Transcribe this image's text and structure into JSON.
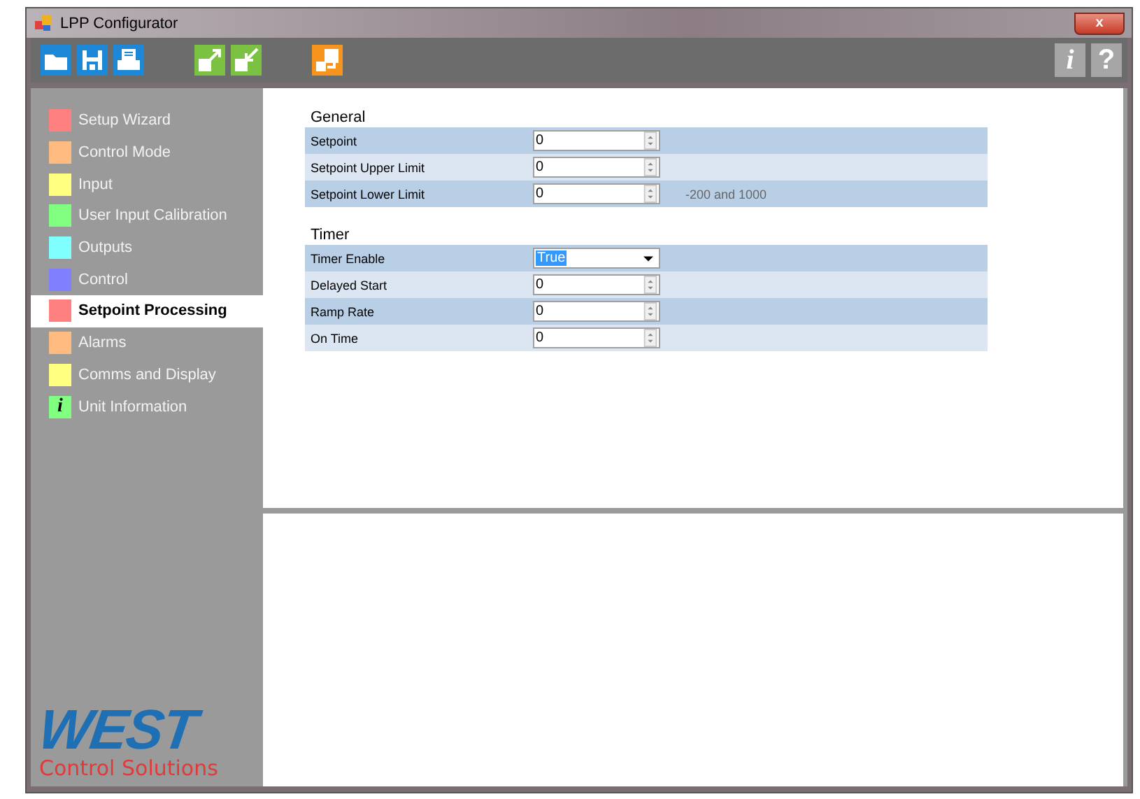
{
  "window": {
    "title": "LPP Configurator",
    "close": "x"
  },
  "toolbar": {
    "help_buttons": [
      "i",
      "?"
    ]
  },
  "sidebar": {
    "items": [
      {
        "label": "Setup Wizard",
        "color": "#ff8080",
        "selected": false,
        "kind": "swatch"
      },
      {
        "label": "Control Mode",
        "color": "#ffbb80",
        "selected": false,
        "kind": "swatch"
      },
      {
        "label": "Input",
        "color": "#ffff80",
        "selected": false,
        "kind": "swatch"
      },
      {
        "label": "User Input Calibration",
        "color": "#80ff80",
        "selected": false,
        "kind": "swatch"
      },
      {
        "label": "Outputs",
        "color": "#80ffff",
        "selected": false,
        "kind": "swatch"
      },
      {
        "label": "Control",
        "color": "#8080ff",
        "selected": false,
        "kind": "swatch"
      },
      {
        "label": "Setpoint Processing",
        "color": "#ff8080",
        "selected": true,
        "kind": "swatch"
      },
      {
        "label": "Alarms",
        "color": "#ffbb80",
        "selected": false,
        "kind": "swatch"
      },
      {
        "label": "Comms and Display",
        "color": "#ffff80",
        "selected": false,
        "kind": "swatch"
      },
      {
        "label": "Unit Information",
        "color": "#80ff80",
        "selected": false,
        "kind": "info",
        "glyph": "i"
      }
    ]
  },
  "sections": [
    {
      "title": "General",
      "rows": [
        {
          "label": "Setpoint",
          "kind": "spin",
          "value": "0"
        },
        {
          "label": "Setpoint Upper Limit",
          "kind": "spin",
          "value": "0"
        },
        {
          "label": "Setpoint Lower Limit",
          "kind": "spin",
          "value": "0",
          "note": "-200 and 1000"
        }
      ]
    },
    {
      "title": "Timer",
      "rows": [
        {
          "label": "Timer Enable",
          "kind": "dropdown",
          "value": "True"
        },
        {
          "label": "Delayed Start",
          "kind": "spin",
          "value": "0"
        },
        {
          "label": "Ramp Rate",
          "kind": "spin",
          "value": "0"
        },
        {
          "label": "On Time",
          "kind": "spin",
          "value": "0"
        }
      ]
    }
  ],
  "logo": {
    "brand": "WEST",
    "tagline": "Control Solutions"
  }
}
